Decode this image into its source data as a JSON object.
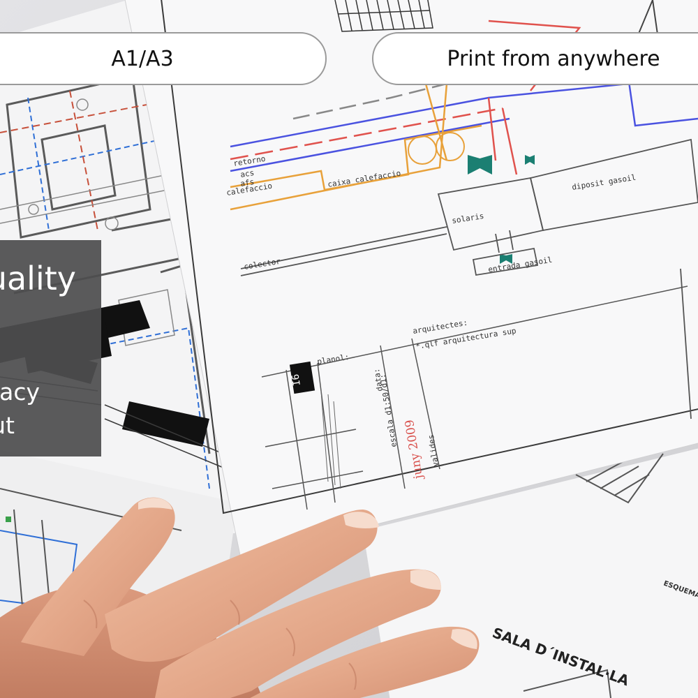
{
  "buttons": {
    "format_label": "A1/A3",
    "remote_label": "Print from anywhere"
  },
  "feature_panel": {
    "title_fragment": "uality",
    "line1_fragment": "acy",
    "line2_fragment": "ut"
  },
  "drawing_labels": {
    "retorno": "retorno",
    "acs": "acs",
    "afs": "afs",
    "calefaccio": "calefaccio",
    "caixa_calefaccio": "caixa calefaccio",
    "colector": "colector",
    "solaris": "solaris",
    "diposit_gasoil": "diposit gasoil",
    "entrada_gasoil": "entrada gasoil",
    "planol": "planol:",
    "arquitectes": "arquitectes:",
    "arquitectes_name": "*.qlf arquitectura sup",
    "escala": "escala d1:50/d1:",
    "data": "data:",
    "date_value": "juny 2009",
    "sheet_id": "I6",
    "valides": "valides",
    "sala": "SALA D´INSTAL·LA",
    "esquema": "ESQUEMA"
  },
  "colors": {
    "pill_border": "#9a9a9a",
    "panel_bg": "#4d4d4f",
    "pipe_red": "#e0524d",
    "pipe_blue": "#4a52e0",
    "pipe_orange": "#e8a13a",
    "valve_teal": "#1b7f72",
    "date_red": "#d9534f"
  }
}
